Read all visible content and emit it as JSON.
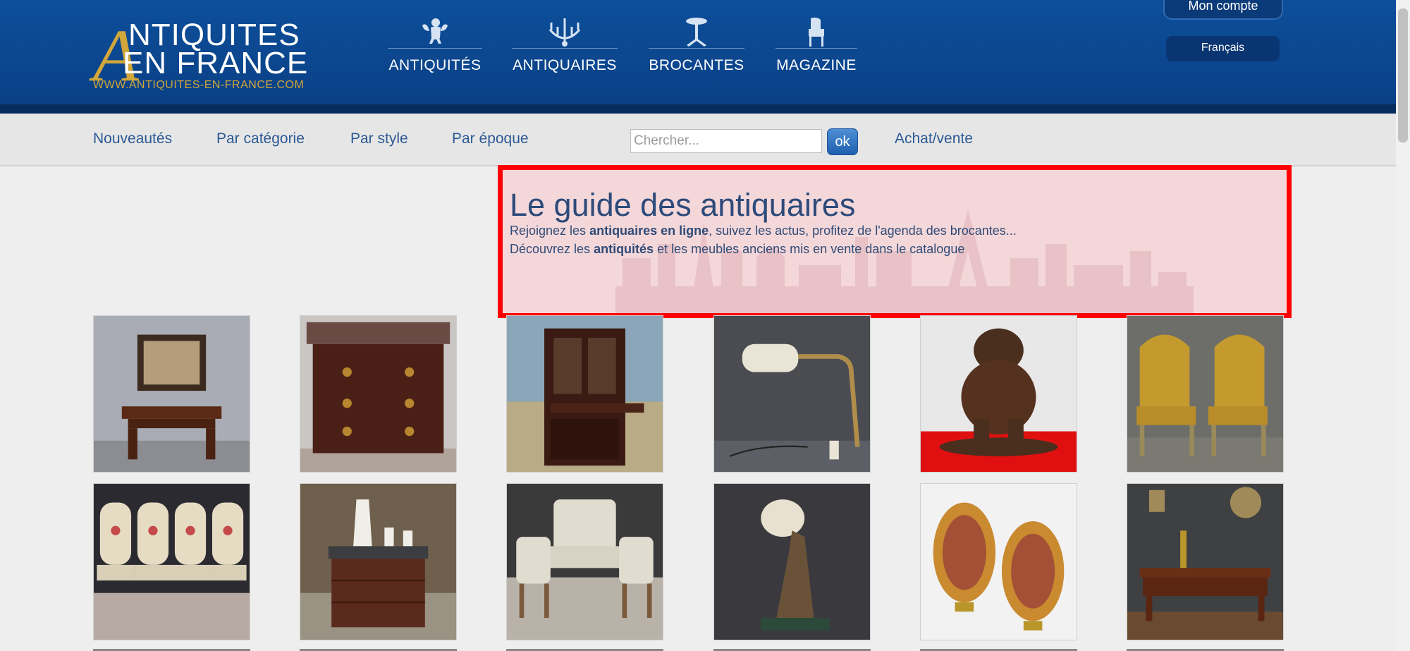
{
  "header": {
    "logo": {
      "big_letter": "A",
      "line1": "NTIQUITES",
      "line2": "EN FRANCE",
      "url": "WWW.ANTIQUITES-EN-FRANCE.COM",
      "gold_color": "#d1a63a"
    },
    "nav": [
      {
        "label": "ANTIQUITÉS",
        "icon": "cherub-icon"
      },
      {
        "label": "ANTIQUAIRES",
        "icon": "chandelier-icon"
      },
      {
        "label": "BROCANTES",
        "icon": "pedestal-table-icon"
      },
      {
        "label": "MAGAZINE",
        "icon": "armchair-icon"
      }
    ],
    "account_label": "Mon compte",
    "language_label": "Français"
  },
  "subnav": {
    "links": [
      "Nouveautés",
      "Par catégorie",
      "Par style",
      "Par époque"
    ],
    "search_placeholder": "Chercher...",
    "ok_label": "ok",
    "buy_sell": "Achat/vente"
  },
  "hero": {
    "title": "Le guide des antiquaires",
    "line1": {
      "pre": "Rejoignez les ",
      "bold": "antiquaires en ligne",
      "post": ", suivez les actus, profitez de l'agenda des brocantes..."
    },
    "line2": {
      "pre": "Découvrez les ",
      "bold": "antiquités",
      "post": " et les meubles anciens mis en vente dans le catalogue"
    },
    "highlight_border": "#ff0000"
  },
  "gallery": [
    {
      "name": "console-with-painting-thumb"
    },
    {
      "name": "marble-top-commode-thumb"
    },
    {
      "name": "secretary-bookcase-thumb"
    },
    {
      "name": "desk-lamp-thumb"
    },
    {
      "name": "carved-bear-thumb"
    },
    {
      "name": "pair-of-armchairs-thumb"
    },
    {
      "name": "set-of-chairs-thumb"
    },
    {
      "name": "small-chest-with-statues-thumb"
    },
    {
      "name": "salon-set-thumb"
    },
    {
      "name": "statue-lamp-thumb"
    },
    {
      "name": "glass-wall-lights-thumb"
    },
    {
      "name": "writing-desk-thumb"
    }
  ]
}
